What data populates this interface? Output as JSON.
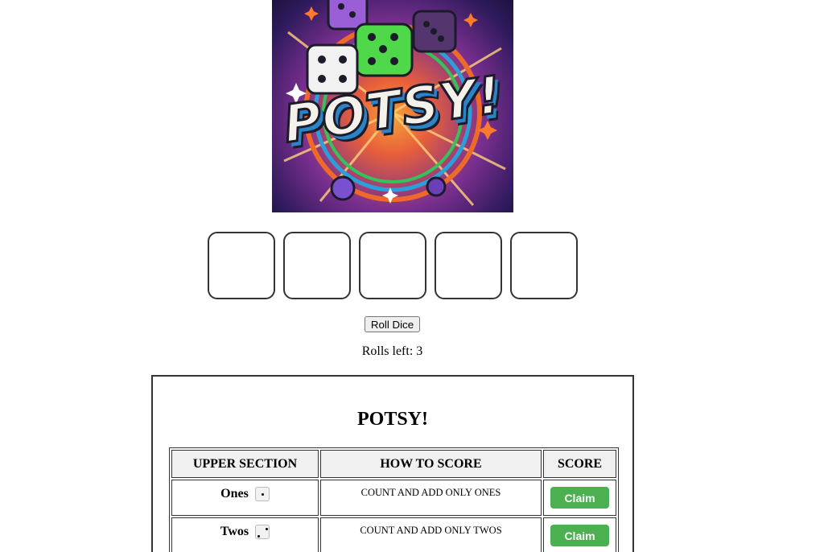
{
  "logo": {
    "text": "POTSY!"
  },
  "dice": {
    "count": 5
  },
  "controls": {
    "roll_label": "Roll Dice",
    "rolls_left_text": "Rolls left: 3"
  },
  "scorecard": {
    "title": "POTSY!",
    "headers": [
      "UPPER SECTION",
      "HOW TO SCORE",
      "SCORE"
    ],
    "rows": [
      {
        "category": "Ones",
        "die_face": 1,
        "how": "COUNT AND ADD ONLY ONES",
        "action": "Claim"
      },
      {
        "category": "Twos",
        "die_face": 2,
        "how": "COUNT AND ADD ONLY TWOS",
        "action": "Claim"
      }
    ]
  },
  "colors": {
    "claim_button": "#4caf50",
    "border": "#333333",
    "header_bg": "#f0f0f0"
  }
}
